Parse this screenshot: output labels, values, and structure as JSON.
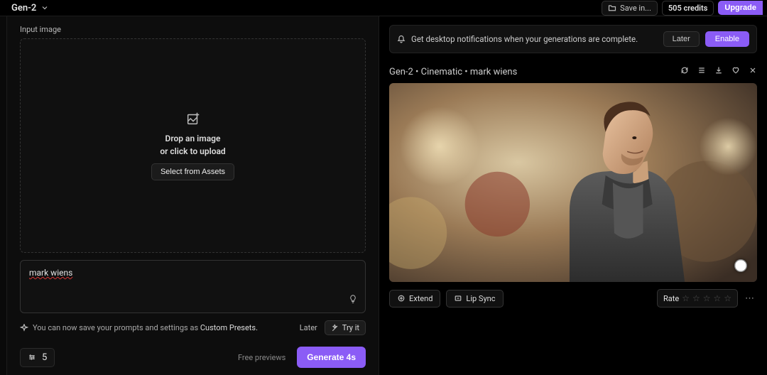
{
  "topbar": {
    "model": "Gen-2",
    "save": "Save in...",
    "credits": "505 credits",
    "upgrade": "Upgrade"
  },
  "left": {
    "input_label": "Input image",
    "drop_line1": "Drop an image",
    "drop_line2": "or click to upload",
    "select_assets": "Select from Assets",
    "prompt_value": "mark wiens",
    "tip_text": "You can now save your prompts and settings as ",
    "tip_link": "Custom Presets.",
    "later": "Later",
    "try_it": "Try it",
    "seed": "5",
    "free_previews": "Free previews",
    "generate": "Generate 4s"
  },
  "right": {
    "notif": "Get desktop notifications when your generations are complete.",
    "notif_later": "Later",
    "notif_enable": "Enable",
    "gen_title": "Gen-2 • Cinematic • mark wiens",
    "extend": "Extend",
    "lipsync": "Lip Sync",
    "rate": "Rate"
  }
}
